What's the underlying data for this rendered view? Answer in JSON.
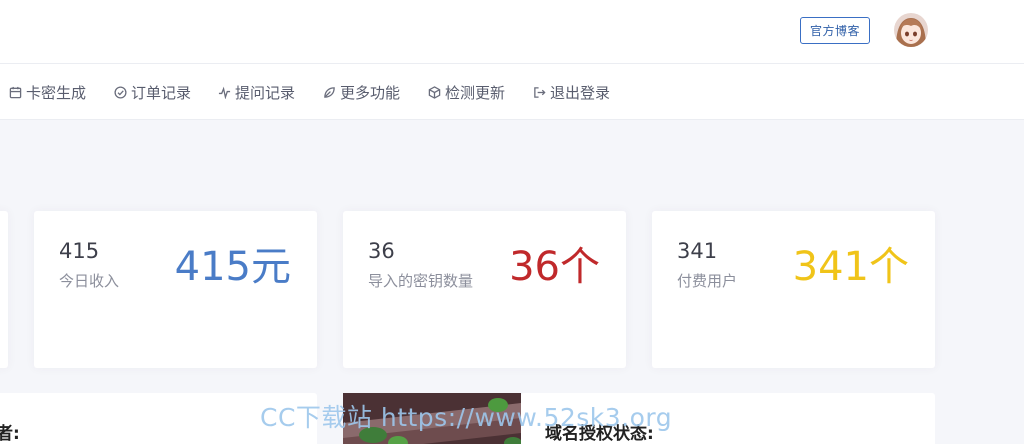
{
  "header": {
    "blog_button": "官方博客",
    "avatar_icon": "anime-avatar-icon"
  },
  "nav": {
    "items": [
      {
        "label": "卡密生成",
        "icon": "calendar-icon"
      },
      {
        "label": "订单记录",
        "icon": "check-circle-icon"
      },
      {
        "label": "提问记录",
        "icon": "pulse-icon"
      },
      {
        "label": "更多功能",
        "icon": "leaf-icon"
      },
      {
        "label": "检测更新",
        "icon": "cube-icon"
      },
      {
        "label": "退出登录",
        "icon": "logout-icon"
      }
    ]
  },
  "stats": [
    {
      "value": "415",
      "label": "今日收入",
      "big": "415元",
      "color": "#4a7cc7"
    },
    {
      "value": "36",
      "label": "导入的密钥数量",
      "big": "36个",
      "color": "#c0292b"
    },
    {
      "value": "341",
      "label": "付费用户",
      "big": "341个",
      "color": "#f0c419"
    }
  ],
  "panels": {
    "left_title": "者:",
    "right_title": "域名授权状态:"
  },
  "watermark": "CC下载站 https://www.52sk3.org"
}
